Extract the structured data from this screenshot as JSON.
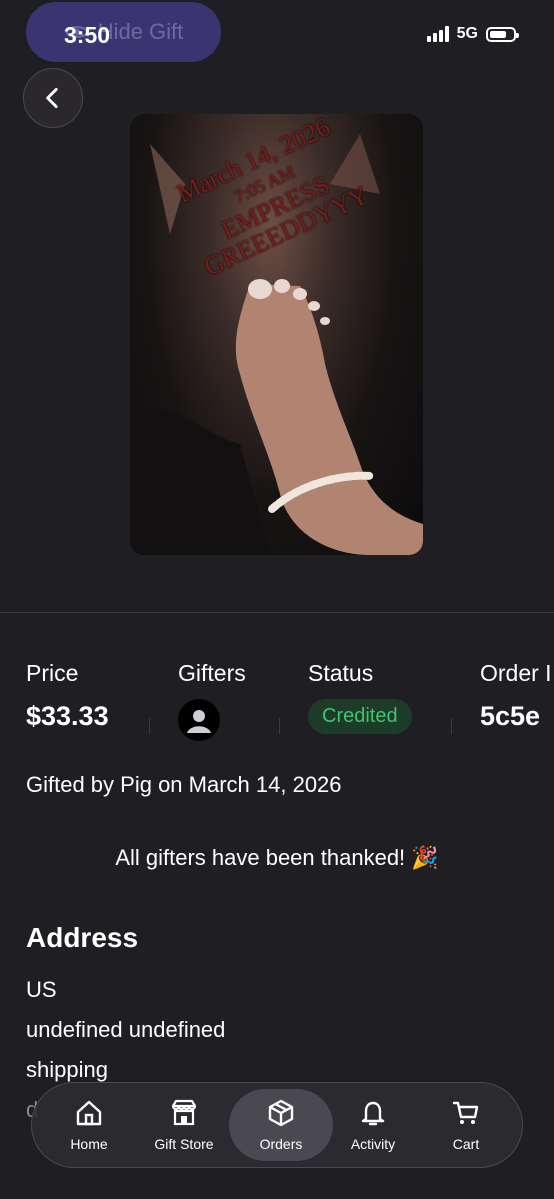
{
  "status_bar": {
    "time": "3:50",
    "network": "5G"
  },
  "hide_gift": {
    "label": "Hide Gift",
    "icon": "eye-icon"
  },
  "back": {
    "icon": "chevron-left-icon"
  },
  "photo": {
    "stamp_lines": [
      "March 14, 2026",
      "7:05 AM",
      "EMPRESS",
      "GREEEDDYYY"
    ]
  },
  "stats": {
    "price": {
      "label": "Price",
      "value": "$33.33"
    },
    "gifters": {
      "label": "Gifters",
      "icon": "user-avatar-icon"
    },
    "status": {
      "label": "Status",
      "value": "Credited",
      "color": "#3ec46a"
    },
    "order": {
      "label": "Order I",
      "value": "5c5e"
    }
  },
  "gifted_by": "Gifted by Pig on March 14, 2026",
  "thanked": "All gifters have been thanked! 🎉",
  "address": {
    "heading": "Address",
    "lines": [
      "US",
      "undefined undefined",
      "shipping",
      "d"
    ]
  },
  "nav": {
    "items": [
      {
        "label": "Home",
        "icon": "home-icon"
      },
      {
        "label": "Gift Store",
        "icon": "store-icon"
      },
      {
        "label": "Orders",
        "icon": "box-icon",
        "active": true
      },
      {
        "label": "Activity",
        "icon": "bell-icon"
      },
      {
        "label": "Cart",
        "icon": "cart-icon"
      }
    ]
  }
}
